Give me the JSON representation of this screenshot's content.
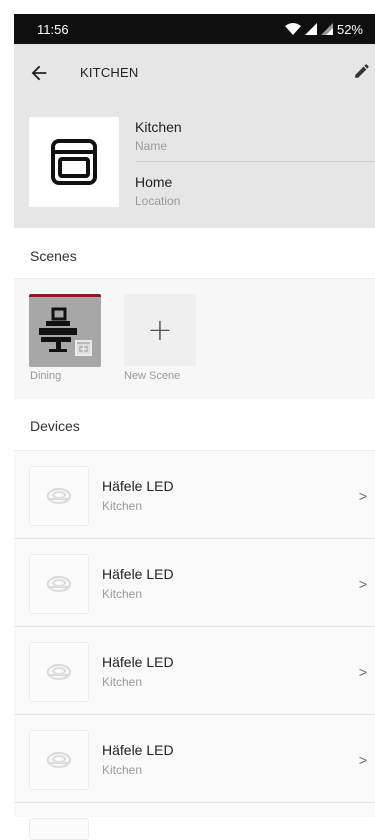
{
  "status_bar": {
    "time": "11:56",
    "battery": "52%"
  },
  "appbar": {
    "title": "KITCHEN"
  },
  "room": {
    "name_value": "Kitchen",
    "name_label": "Name",
    "location_value": "Home",
    "location_label": "Location"
  },
  "scenes": {
    "heading": "Scenes",
    "items": [
      {
        "label": "Dining"
      },
      {
        "label": "New Scene",
        "glyph": "+"
      }
    ]
  },
  "devices": {
    "heading": "Devices",
    "items": [
      {
        "name": "Häfele LED",
        "room": "Kitchen"
      },
      {
        "name": "Häfele LED",
        "room": "Kitchen"
      },
      {
        "name": "Häfele LED",
        "room": "Kitchen"
      },
      {
        "name": "Häfele LED",
        "room": "Kitchen"
      }
    ]
  },
  "colors": {
    "accent": "#8e1a26",
    "header_bg": "#e6e6e6"
  }
}
